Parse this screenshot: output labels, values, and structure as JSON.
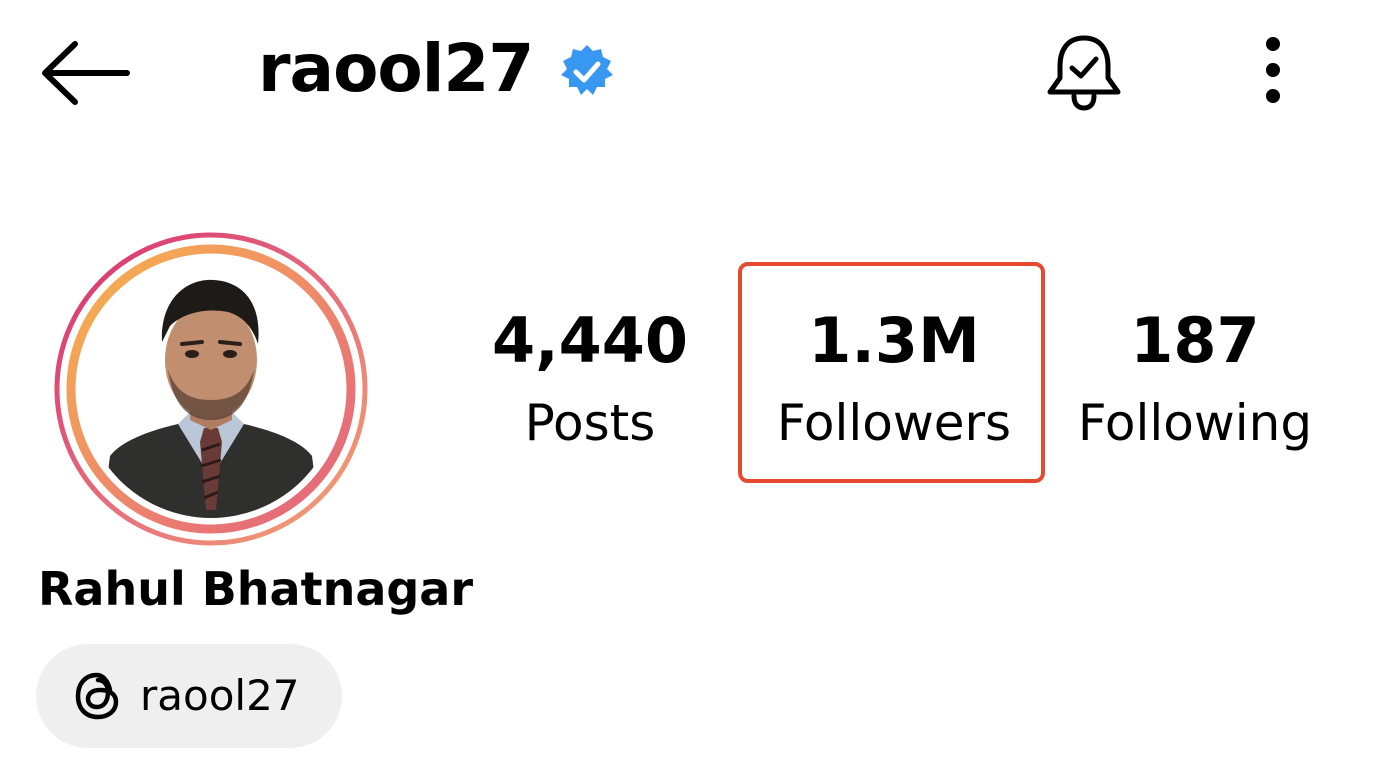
{
  "header": {
    "username": "raool27",
    "back_icon": "arrow-left-icon",
    "verified_icon": "verified-badge-icon",
    "verified_color": "#3897f0",
    "notification_icon": "bell-check-icon",
    "more_icon": "more-vertical-icon"
  },
  "profile": {
    "avatar": "profile-photo",
    "story_ring_colors": [
      "#d6306f",
      "#e8707d",
      "#f6b44a"
    ],
    "full_name": "Rahul Bhatnagar"
  },
  "stats": {
    "posts": {
      "value": "4,440",
      "label": "Posts"
    },
    "followers": {
      "value": "1.3M",
      "label": "Followers"
    },
    "following": {
      "value": "187",
      "label": "Following"
    }
  },
  "highlight": {
    "target": "followers",
    "color": "#e44a2f"
  },
  "threads": {
    "icon": "threads-icon",
    "handle": "raool27"
  }
}
